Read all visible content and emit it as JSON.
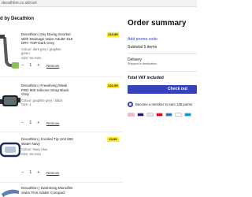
{
  "browser": {
    "url": "decathlon.co.uk/cart"
  },
  "cart": {
    "sold_by": "d by Decathlon",
    "items": [
      {
        "name_line1": "Decathlon | Dry Diving Snorkel",
        "name_line2": "With Drainage Valve Adults' 510",
        "name_line3": "DRY TOP Dark Grey",
        "meta1": "Colour: dark grey / graphite",
        "meta2": "green",
        "meta3": "Size: No Size",
        "price": "£13.99",
        "qty": {
          "minus": "−",
          "value": "1",
          "plus": "+"
        },
        "remove": "Remove"
      },
      {
        "name_line1": "Decathlon | Freediving Mask",
        "name_line2": "FRD 900 Silicone Strap Black",
        "name_line3": "Grey",
        "meta1": "Colour: graphite grey / black",
        "meta2": "Size: 1",
        "price": "£22.99",
        "qty": {
          "minus": "−",
          "value": "1",
          "plus": "+"
        },
        "remove": "Remove"
      },
      {
        "name_line1": "Decathlon | Snorkel Tip Unit 500",
        "name_line2": "Water Navy",
        "meta1": "Colour: Navy blue",
        "meta2": "Size: No Size",
        "price": "£3.99",
        "qty": {
          "minus": "−",
          "value": "1",
          "plus": "+"
        },
        "remove": "Remove"
      },
      {
        "name_line1": "Decathlon | Swimming Monofilm",
        "name_line2": "Swim Fins Adults' Compact"
      }
    ]
  },
  "summary": {
    "title": "Order summary",
    "promo": "Add promo code",
    "subtotal": "Subtotal 5 items",
    "delivery": "Delivery",
    "delivery_note": "Shipped in destination",
    "total": "Total VAT included",
    "checkout": "Check out",
    "member": "Become a member to earn 135 points",
    "payments": [
      "#ffb3c7",
      "#1a1f71",
      "#e8e8e8",
      "#eb001b",
      "#2e77bc",
      "#ffffff",
      "#009cde"
    ]
  }
}
